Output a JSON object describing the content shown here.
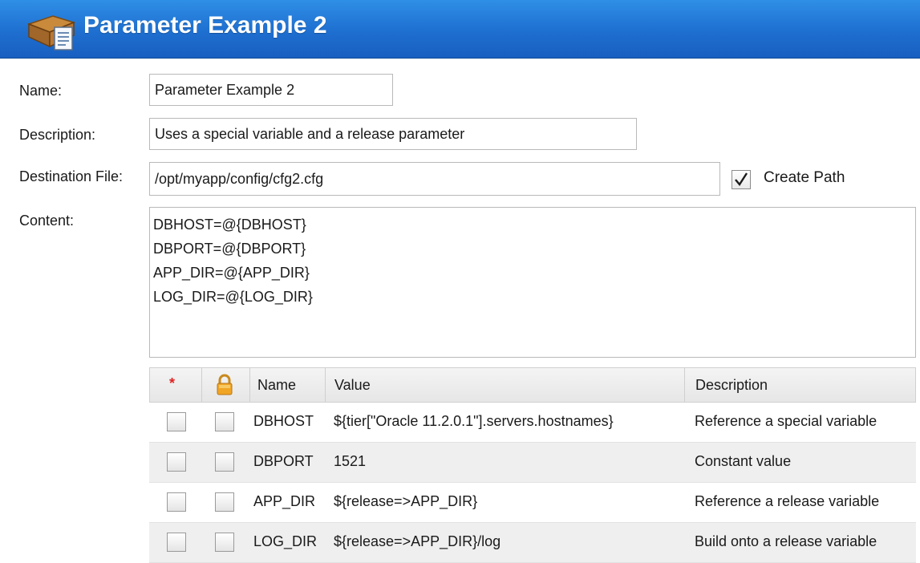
{
  "header": {
    "title": "Parameter Example 2",
    "icon": "parameter-file-icon",
    "gradient": [
      "#2f8fe6",
      "#185fc0"
    ]
  },
  "form": {
    "name_label": "Name:",
    "name_value": "Parameter Example 2",
    "description_label": "Description:",
    "description_value": "Uses a special variable and a release parameter",
    "destination_label": "Destination File:",
    "destination_value": "/opt/myapp/config/cfg2.cfg",
    "create_path_label": "Create Path",
    "create_path_checked": true,
    "content_label": "Content:",
    "content_lines": [
      "DBHOST=@{DBHOST}",
      "DBPORT=@{DBPORT}",
      "APP_DIR=@{APP_DIR}",
      "LOG_DIR=@{LOG_DIR}"
    ]
  },
  "table": {
    "required_marker": "*",
    "locked_icon": "lock-icon",
    "columns": {
      "name": "Name",
      "value": "Value",
      "description": "Description"
    },
    "rows": [
      {
        "required": false,
        "locked": false,
        "name": "DBHOST",
        "value": "${tier[\"Oracle 11.2.0.1\"].servers.hostnames}",
        "description": "Reference a special variable"
      },
      {
        "required": false,
        "locked": false,
        "name": "DBPORT",
        "value": "1521",
        "description": "Constant value"
      },
      {
        "required": false,
        "locked": false,
        "name": "APP_DIR",
        "value": "${release=>APP_DIR}",
        "description": "Reference a release variable"
      },
      {
        "required": false,
        "locked": false,
        "name": "LOG_DIR",
        "value": "${release=>APP_DIR}/log",
        "description": "Build onto a release variable"
      }
    ]
  }
}
